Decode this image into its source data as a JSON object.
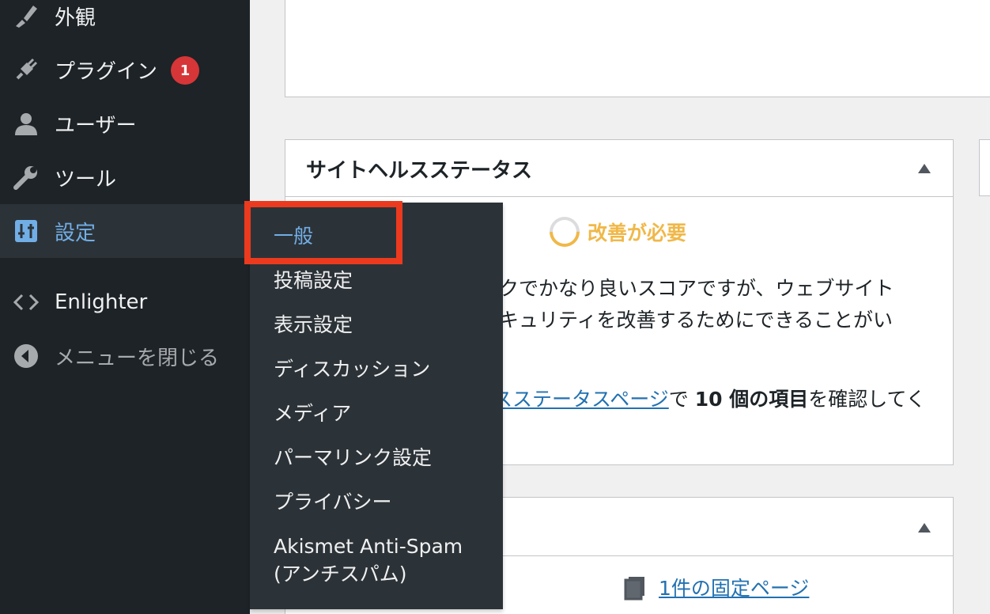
{
  "sidebar": {
    "items": [
      {
        "label": "外観",
        "icon": "paintbrush-icon"
      },
      {
        "label": "プラグイン",
        "icon": "plugin-icon",
        "badge": "1"
      },
      {
        "label": "ユーザー",
        "icon": "user-icon"
      },
      {
        "label": "ツール",
        "icon": "wrench-icon"
      },
      {
        "label": "設定",
        "icon": "settings-icon"
      },
      {
        "label": "Enlighter",
        "icon": "code-icon"
      },
      {
        "label": "メニューを閉じる",
        "icon": "collapse-icon"
      }
    ]
  },
  "flyout": {
    "items": [
      {
        "label": "一般"
      },
      {
        "label": "投稿設定"
      },
      {
        "label": "表示設定"
      },
      {
        "label": "ディスカッション"
      },
      {
        "label": "メディア"
      },
      {
        "label": "パーマリンク設定"
      },
      {
        "label": "プライバシー"
      },
      {
        "label": "Akismet Anti-Spam",
        "label2": "(アンチスパム)"
      }
    ]
  },
  "site_health": {
    "title": "サイトヘルスステータス",
    "status": "改善が必要",
    "line1": "ックでかなり良いスコアですが、ウェブサイト",
    "line2": "セキュリティを改善するためにできることがい",
    "line3_link": "スステータスページ",
    "line3_mid": "で ",
    "line3_bold": "10 個の項目",
    "line3_end": "を確認してく"
  },
  "glance": {
    "page_link": "1件の固定ページ"
  },
  "colors": {
    "sidebar_bg": "#1d2327",
    "submenu_bg": "#2c3338",
    "accent_blue": "#72aee6",
    "highlight": "#ec3a1f",
    "warning": "#f0b849",
    "badge": "#d63638"
  }
}
